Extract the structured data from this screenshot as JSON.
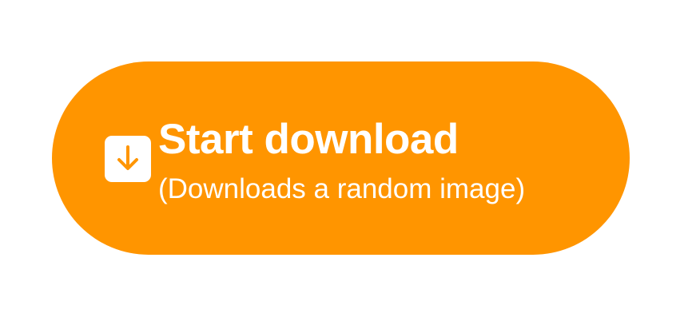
{
  "button": {
    "title": "Start download",
    "subtitle": "(Downloads a random image)",
    "icon": "download-arrow-icon",
    "background_color": "#FF9500"
  }
}
